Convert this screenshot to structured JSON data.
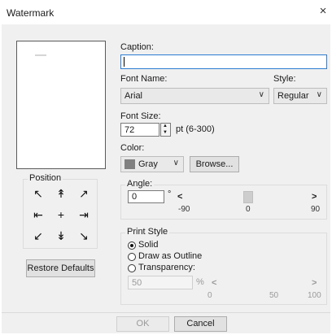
{
  "window": {
    "title": "Watermark",
    "close_glyph": "×"
  },
  "caption": {
    "label": "Caption:",
    "value": ""
  },
  "font_name": {
    "label": "Font Name:",
    "value": "Arial"
  },
  "style": {
    "label": "Style:",
    "value": "Regular"
  },
  "font_size": {
    "label": "Font Size:",
    "value": "72",
    "range_text": "pt (6-300)"
  },
  "color": {
    "label": "Color:",
    "value": "Gray",
    "swatch": "#808080",
    "browse_label": "Browse..."
  },
  "position": {
    "label": "Position",
    "arrows": [
      "↖",
      "↟",
      "↗",
      "⇤",
      "+",
      "⇥",
      "↙",
      "↡",
      "↘"
    ],
    "restore_label": "Restore Defaults"
  },
  "angle": {
    "label": "Angle:",
    "value": "0",
    "unit": "°",
    "left_arrow": "<",
    "right_arrow": ">",
    "ticks": [
      "-90",
      "0",
      "90"
    ],
    "level": 0.5
  },
  "print_style": {
    "label": "Print Style",
    "options": [
      {
        "label": "Solid",
        "selected": true
      },
      {
        "label": "Draw as Outline",
        "selected": false
      },
      {
        "label": "Transparency:",
        "selected": false
      }
    ],
    "transparency_value": "50",
    "transparency_unit": "%",
    "left_arrow": "<",
    "right_arrow": ">",
    "ticks": [
      "0",
      "50",
      "100"
    ]
  },
  "footer": {
    "ok_label": "OK",
    "cancel_label": "Cancel"
  },
  "icons": {
    "dropdown": "chevron-down-icon",
    "spin": "spinner-icon"
  }
}
